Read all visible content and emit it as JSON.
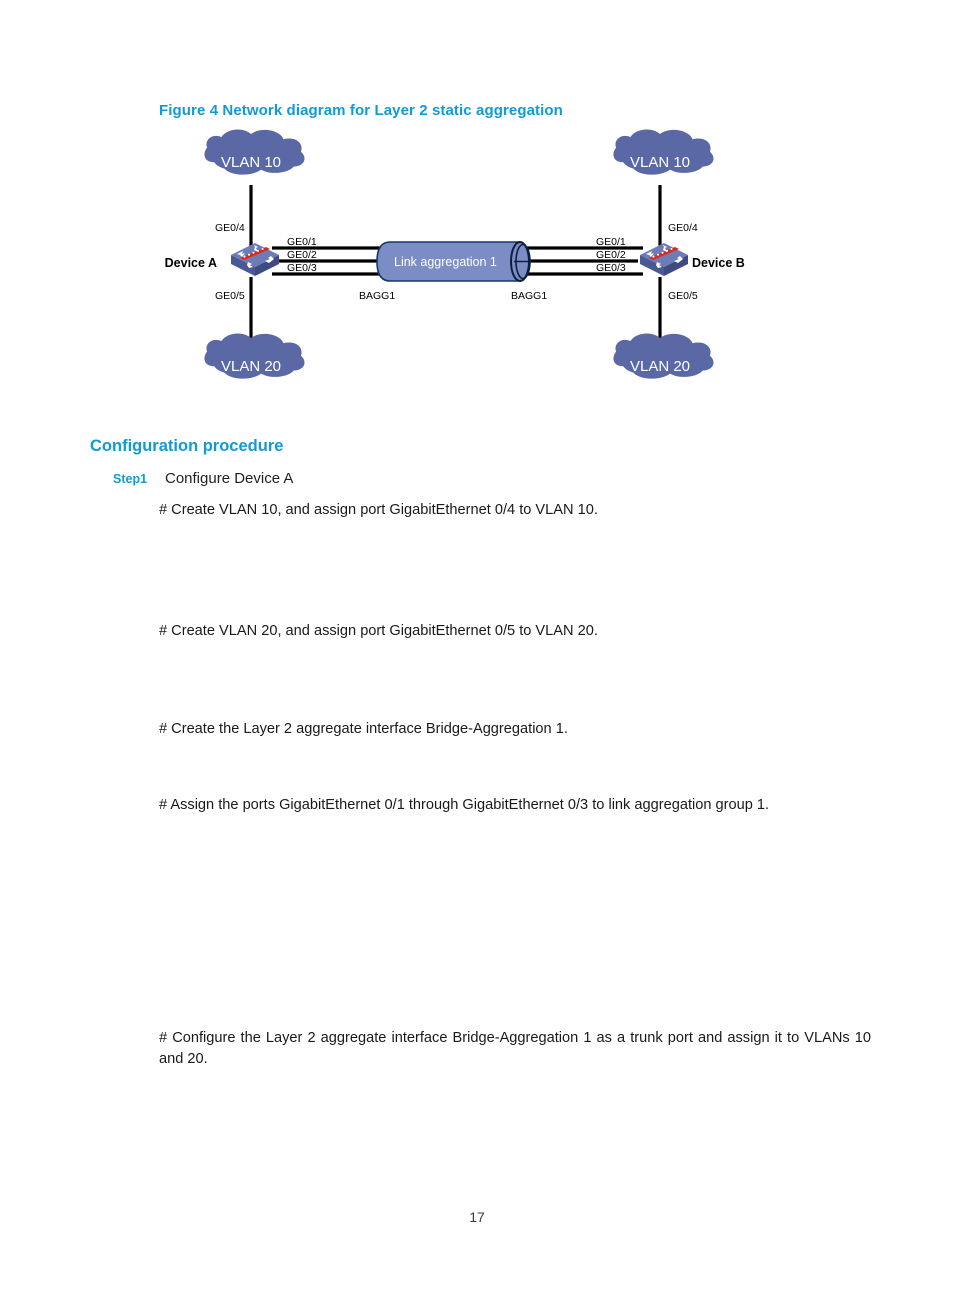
{
  "figure": {
    "caption": "Figure 4 Network diagram for Layer 2 static aggregation",
    "caption_color": "#0f9bd7",
    "cloud_color": "#5a68a6",
    "link_tube_color": "#7c8cc4",
    "switch_color": "#5a68a6",
    "switch_accent_color": "#d92a1c",
    "nodes": {
      "cloud_top_left": "VLAN 10",
      "cloud_top_right": "VLAN 10",
      "cloud_bottom_left": "VLAN 20",
      "cloud_bottom_right": "VLAN 20",
      "device_left": "Device A",
      "device_right": "Device B",
      "aggregation": "Link aggregation 1"
    },
    "ports": {
      "left_top": "GE0/4",
      "left_bottom": "GE0/5",
      "right_top": "GE0/4",
      "right_bottom": "GE0/5",
      "left_links": [
        "GE0/1",
        "GE0/2",
        "GE0/3"
      ],
      "right_links": [
        "GE0/1",
        "GE0/2",
        "GE0/3"
      ],
      "bagg_left": "BAGG1",
      "bagg_right": "BAGG1"
    }
  },
  "section": {
    "heading": "Configuration procedure",
    "step": {
      "tag": "Step1",
      "text": "Configure Device A"
    },
    "paragraphs": [
      "# Create VLAN 10, and assign port GigabitEthernet 0/4 to VLAN 10.",
      "# Create VLAN 20, and assign port GigabitEthernet 0/5 to VLAN 20.",
      "# Create the Layer 2 aggregate interface Bridge-Aggregation 1.",
      "# Assign the ports GigabitEthernet 0/1 through GigabitEthernet 0/3 to link aggregation group 1.",
      "# Configure the Layer 2 aggregate interface Bridge-Aggregation 1 as a trunk port and assign it to VLANs 10 and 20."
    ]
  },
  "footer": {
    "page_number": "17"
  }
}
